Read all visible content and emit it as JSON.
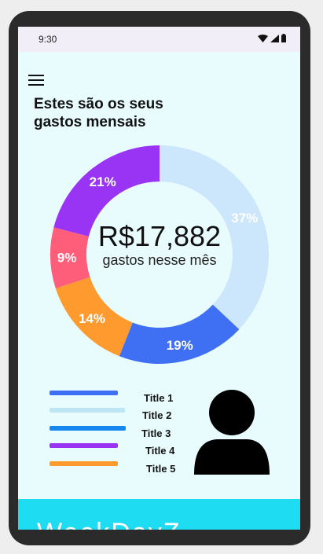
{
  "status": {
    "time": "9:30"
  },
  "header": {
    "title": "Estes são os seus gastos mensais"
  },
  "summary": {
    "amount": "R$17,882",
    "subtitle": "gastos nesse mês"
  },
  "chart_data": {
    "type": "pie",
    "slices": [
      {
        "label": "37%",
        "value": 37,
        "color": "#cce6fb"
      },
      {
        "label": "19%",
        "value": 19,
        "color": "#3f6ff2"
      },
      {
        "label": "14%",
        "value": 14,
        "color": "#ff9a2e"
      },
      {
        "label": "9%",
        "value": 9,
        "color": "#ff5e7a"
      },
      {
        "label": "21%",
        "value": 21,
        "color": "#9a34f5"
      }
    ]
  },
  "legend": [
    {
      "title": "Title 1",
      "color": "#3f6ff2"
    },
    {
      "title": "Title 2",
      "color": "#bfe6f5"
    },
    {
      "title": "Title 3",
      "color": "#1588f0"
    },
    {
      "title": "Title 4",
      "color": "#9a34f5"
    },
    {
      "title": "Title 5",
      "color": "#ff9a2e"
    }
  ],
  "footer": {
    "text": "WeekDayZ"
  }
}
